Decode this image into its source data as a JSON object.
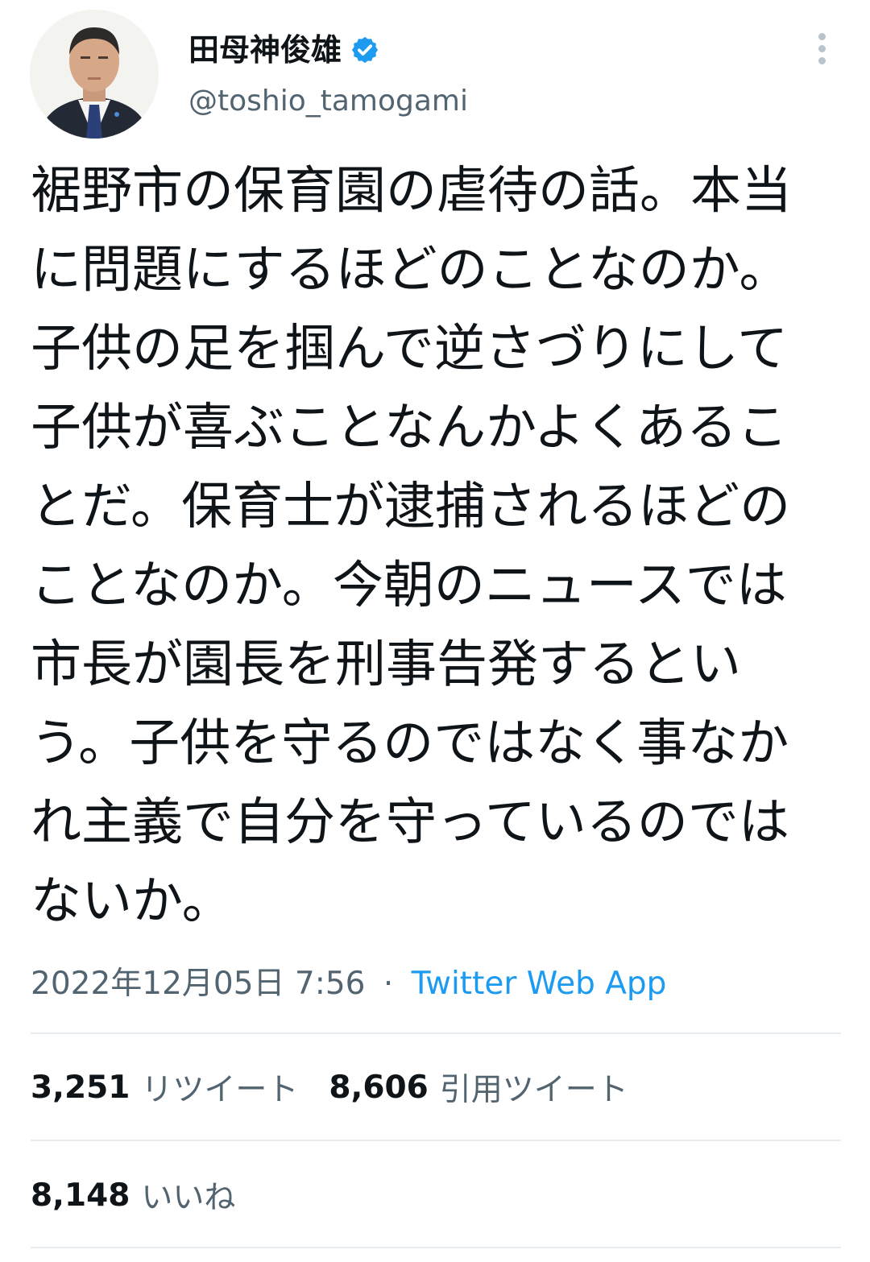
{
  "author": {
    "display_name": "田母神俊雄",
    "handle": "@toshio_tamogami",
    "verified": true,
    "avatar_icon": "profile-photo",
    "verified_icon": "verified-badge-icon",
    "more_icon": "vertical-dots-icon"
  },
  "tweet": {
    "lines": [
      "裾野市の保育園の虐待の話。本当",
      "に問題にするほどのことなのか。",
      "子供の足を掴んで逆さづりにして",
      "子供が喜ぶことなんかよくあるこ",
      "とだ。保育士が逮捕されるほどの",
      "ことなのか。今朝のニュースでは",
      "市長が園長を刑事告発するとい",
      "う。子供を守るのではなく事なか",
      "れ主義で自分を守っているのでは",
      "ないか。"
    ]
  },
  "meta": {
    "timestamp": "2022年12月05日 7:56",
    "separator": "·",
    "source": "Twitter Web App"
  },
  "stats": {
    "retweets": {
      "count": "3,251",
      "label": "リツイート"
    },
    "quotes": {
      "count": "8,606",
      "label": "引用ツイート"
    },
    "likes": {
      "count": "8,148",
      "label": "いいね"
    }
  },
  "colors": {
    "text_primary": "#0f1419",
    "text_secondary": "#536471",
    "accent": "#1d9bf0",
    "divider": "#e6ecf0"
  }
}
